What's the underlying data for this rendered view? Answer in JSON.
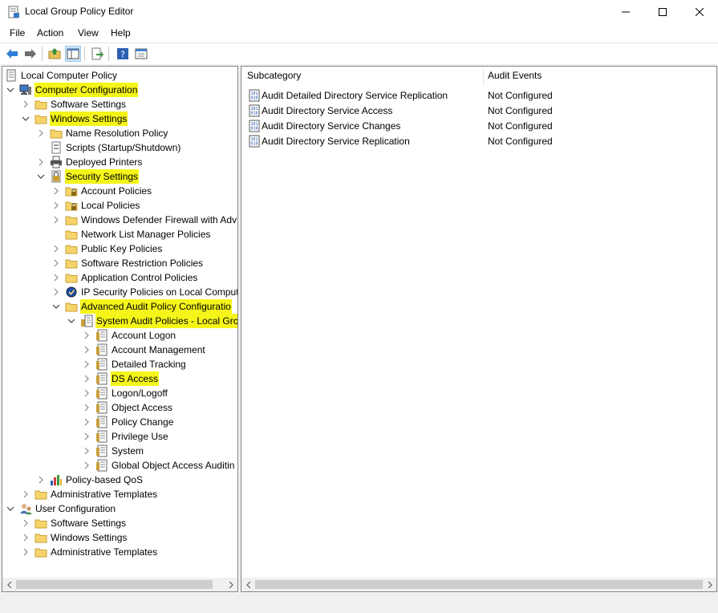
{
  "window": {
    "title": "Local Group Policy Editor",
    "controls": [
      "minimize",
      "maximize",
      "close"
    ]
  },
  "menu": [
    "File",
    "Action",
    "View",
    "Help"
  ],
  "toolbar": [
    "back-icon",
    "forward-icon",
    "up-folder-icon",
    "show-hide-tree-icon",
    "export-list-icon",
    "help-icon",
    "properties-icon"
  ],
  "tree": [
    {
      "label": "Local Computer Policy",
      "icon": "policy-icon",
      "exp": "none",
      "level": 0,
      "hl": false
    },
    {
      "label": "Computer Configuration",
      "icon": "computer-icon",
      "exp": "open",
      "level": 0,
      "hl": true
    },
    {
      "label": "Software Settings",
      "icon": "folder-icon",
      "exp": "closed",
      "level": 1,
      "hl": false
    },
    {
      "label": "Windows Settings",
      "icon": "folder-icon",
      "exp": "open",
      "level": 1,
      "hl": true
    },
    {
      "label": "Name Resolution Policy",
      "icon": "folder-icon",
      "exp": "closed",
      "level": 2,
      "hl": false
    },
    {
      "label": "Scripts (Startup/Shutdown)",
      "icon": "script-icon",
      "exp": "none",
      "level": 2,
      "hl": false
    },
    {
      "label": "Deployed Printers",
      "icon": "printer-icon",
      "exp": "closed",
      "level": 2,
      "hl": false
    },
    {
      "label": "Security Settings",
      "icon": "security-icon",
      "exp": "open",
      "level": 2,
      "hl": true
    },
    {
      "label": "Account Policies",
      "icon": "lock-folder-icon",
      "exp": "closed",
      "level": 3,
      "hl": false
    },
    {
      "label": "Local Policies",
      "icon": "lock-folder-icon",
      "exp": "closed",
      "level": 3,
      "hl": false
    },
    {
      "label": "Windows Defender Firewall with Adv",
      "icon": "folder-icon",
      "exp": "closed",
      "level": 3,
      "hl": false
    },
    {
      "label": "Network List Manager Policies",
      "icon": "folder-icon",
      "exp": "none",
      "level": 3,
      "hl": false
    },
    {
      "label": "Public Key Policies",
      "icon": "folder-icon",
      "exp": "closed",
      "level": 3,
      "hl": false
    },
    {
      "label": "Software Restriction Policies",
      "icon": "folder-icon",
      "exp": "closed",
      "level": 3,
      "hl": false
    },
    {
      "label": "Application Control Policies",
      "icon": "folder-icon",
      "exp": "closed",
      "level": 3,
      "hl": false
    },
    {
      "label": "IP Security Policies on Local Comput",
      "icon": "ipsec-icon",
      "exp": "closed",
      "level": 3,
      "hl": false
    },
    {
      "label": "Advanced Audit Policy Configuratio",
      "icon": "folder-icon",
      "exp": "open",
      "level": 3,
      "hl": true
    },
    {
      "label": "System Audit Policies - Local Grc",
      "icon": "audit-policy-icon",
      "exp": "open",
      "level": 4,
      "hl": true
    },
    {
      "label": "Account Logon",
      "icon": "audit-category-icon",
      "exp": "closed",
      "level": 5,
      "hl": false
    },
    {
      "label": "Account Management",
      "icon": "audit-category-icon",
      "exp": "closed",
      "level": 5,
      "hl": false
    },
    {
      "label": "Detailed Tracking",
      "icon": "audit-category-icon",
      "exp": "closed",
      "level": 5,
      "hl": false
    },
    {
      "label": "DS Access",
      "icon": "audit-category-icon",
      "exp": "closed",
      "level": 5,
      "hl": true
    },
    {
      "label": "Logon/Logoff",
      "icon": "audit-category-icon",
      "exp": "closed",
      "level": 5,
      "hl": false
    },
    {
      "label": "Object Access",
      "icon": "audit-category-icon",
      "exp": "closed",
      "level": 5,
      "hl": false
    },
    {
      "label": "Policy Change",
      "icon": "audit-category-icon",
      "exp": "closed",
      "level": 5,
      "hl": false
    },
    {
      "label": "Privilege Use",
      "icon": "audit-category-icon",
      "exp": "closed",
      "level": 5,
      "hl": false
    },
    {
      "label": "System",
      "icon": "audit-category-icon",
      "exp": "closed",
      "level": 5,
      "hl": false
    },
    {
      "label": "Global Object Access Auditin",
      "icon": "audit-category-icon",
      "exp": "closed",
      "level": 5,
      "hl": false
    },
    {
      "label": "Policy-based QoS",
      "icon": "qos-chart-icon",
      "exp": "closed",
      "level": 2,
      "hl": false
    },
    {
      "label": "Administrative Templates",
      "icon": "folder-icon",
      "exp": "closed",
      "level": 1,
      "hl": false
    },
    {
      "label": "User Configuration",
      "icon": "user-icon",
      "exp": "open",
      "level": 0,
      "hl": false
    },
    {
      "label": "Software Settings",
      "icon": "folder-icon",
      "exp": "closed",
      "level": 1,
      "hl": false
    },
    {
      "label": "Windows Settings",
      "icon": "folder-icon",
      "exp": "closed",
      "level": 1,
      "hl": false
    },
    {
      "label": "Administrative Templates",
      "icon": "folder-icon",
      "exp": "closed",
      "level": 1,
      "hl": false
    }
  ],
  "list": {
    "columns": [
      "Subcategory",
      "Audit Events"
    ],
    "rows": [
      {
        "subcategory": "Audit Detailed Directory Service Replication",
        "events": "Not Configured"
      },
      {
        "subcategory": "Audit Directory Service Access",
        "events": "Not Configured"
      },
      {
        "subcategory": "Audit Directory Service Changes",
        "events": "Not Configured"
      },
      {
        "subcategory": "Audit Directory Service Replication",
        "events": "Not Configured"
      }
    ]
  }
}
